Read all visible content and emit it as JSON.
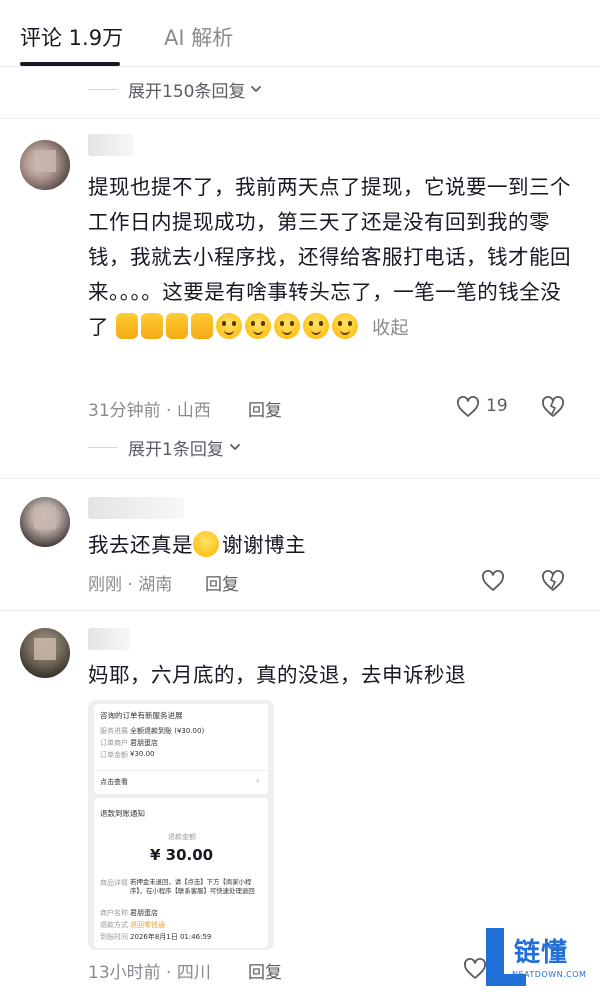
{
  "tabs": {
    "comments": "评论 1.9万",
    "ai": "AI 解析"
  },
  "comments": [
    {
      "expand_above": "展开150条回复",
      "text": "提现也提不了，我前两天点了提现，它说要一到三个工作日内提现成功，第三天了还是没有回到我的零钱，我就去小程序找，还得给客服打电话，钱才能回来。。。。这要是有啥事转头忘了，一笔一笔的钱全没了",
      "collapse": "收起",
      "meta": "31分钟前 · 山西",
      "reply": "回复",
      "likes": "19",
      "expand_below": "展开1条回复"
    },
    {
      "text_a": "我去还真是",
      "text_b": "谢谢博主",
      "meta": "刚刚 · 湖南",
      "reply": "回复"
    },
    {
      "text": "妈耶，六月底的，真的没退，去申诉秒退",
      "meta": "13小时前 · 四川",
      "reply": "回复",
      "screenshot": {
        "card1_title": "咨询的订单有新服务进展",
        "r1_label": "服务进展",
        "r1_value": "全额退款到账 (¥30.00)",
        "r2_label": "订单商户",
        "r2_value": "君朋蛋店",
        "r3_label": "订单金额",
        "r3_value": "¥30.00",
        "view": "点击查看",
        "card2_title": "退款到账通知",
        "amount_label": "退款金额",
        "amount": "¥ 30.00",
        "d1_label": "商品详情",
        "d1_value": "若押金未退回，请【点击】下方【商家小程序】，在小程序【联系客服】可快速处理退回",
        "d2_label": "商户名称",
        "d2_value": "君朋蛋店",
        "d3_label": "退款方式",
        "d3_value": "退回零钱通",
        "d4_label": "到账时间",
        "d4_value": "2026年8月1日 01:46:59"
      }
    }
  ],
  "watermark": {
    "brand": "链懂",
    "domain": "NEATDOWN.COM"
  }
}
